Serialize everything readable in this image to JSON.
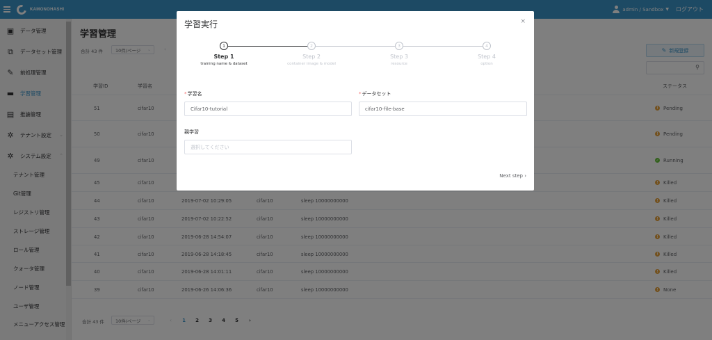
{
  "header": {
    "logo_text": "KAMONOHASHI",
    "user": "admin / Sandbox",
    "caret": "▼",
    "logout": "ログアウト"
  },
  "sidebar": {
    "items": [
      {
        "label": "データ管理",
        "icon": "data-icon",
        "glyph": "▣"
      },
      {
        "label": "データセット管理",
        "icon": "dataset-icon",
        "glyph": "⧉"
      },
      {
        "label": "前処理管理",
        "icon": "edit-icon",
        "glyph": "✎"
      },
      {
        "label": "学習管理",
        "icon": "training-icon",
        "glyph": "▬"
      },
      {
        "label": "推論管理",
        "icon": "inference-icon",
        "glyph": "▤"
      },
      {
        "label": "テナント設定",
        "icon": "gear-icon",
        "glyph": "✲",
        "chevron": "⌄"
      },
      {
        "label": "システム設定",
        "icon": "gears-icon",
        "glyph": "✲",
        "chevron": "⌃"
      }
    ],
    "sub_items": [
      "テナント管理",
      "Git管理",
      "レジストリ管理",
      "ストレージ管理",
      "ロール管理",
      "クォータ管理",
      "ノード管理",
      "ユーザ管理",
      "メニューアクセス管理"
    ]
  },
  "main": {
    "title": "学習管理",
    "total": "合計 43 件",
    "per_page": "10件/ページ",
    "new_button": "新規登録",
    "columns": [
      "学習ID",
      "学習名",
      "ステータス"
    ],
    "rows": [
      {
        "id": "51",
        "name": "cifar10",
        "date": "",
        "dataset": "",
        "command": "",
        "status": "Pending",
        "color": "#e6a23c",
        "sym": "!"
      },
      {
        "id": "50",
        "name": "cifar10",
        "date": "",
        "dataset": "",
        "command": "",
        "status": "Pending",
        "color": "#e6a23c",
        "sym": "!"
      },
      {
        "id": "49",
        "name": "cifar10",
        "date": "",
        "dataset": "",
        "command": "",
        "status": "Running",
        "color": "#67c23a",
        "sym": "✓"
      },
      {
        "id": "45",
        "name": "cifar10",
        "date": "",
        "dataset": "",
        "command": "",
        "status": "Killed",
        "color": "#e6a23c",
        "sym": "!"
      },
      {
        "id": "44",
        "name": "cifar10",
        "date": "2019-07-02 10:29:05",
        "dataset": "cifar10",
        "command": "sleep 10000000000",
        "status": "Killed",
        "color": "#e6a23c",
        "sym": "!"
      },
      {
        "id": "43",
        "name": "cifar10",
        "date": "2019-07-02 10:22:52",
        "dataset": "cifar10",
        "command": "sleep 10000000000",
        "status": "Killed",
        "color": "#e6a23c",
        "sym": "!"
      },
      {
        "id": "42",
        "name": "cifar10",
        "date": "2019-06-28 14:54:07",
        "dataset": "cifar10",
        "command": "sleep 10000000000",
        "status": "Killed",
        "color": "#e6a23c",
        "sym": "!"
      },
      {
        "id": "41",
        "name": "cifar10",
        "date": "2019-06-28 14:18:45",
        "dataset": "cifar10",
        "command": "sleep 10000000000",
        "status": "Killed",
        "color": "#e6a23c",
        "sym": "!"
      },
      {
        "id": "40",
        "name": "cifar10",
        "date": "2019-06-28 14:01:11",
        "dataset": "cifar10",
        "command": "sleep 10000000000",
        "status": "Killed",
        "color": "#e6a23c",
        "sym": "!"
      },
      {
        "id": "39",
        "name": "cifar10",
        "date": "2019-06-26 14:06:36",
        "dataset": "cifar10",
        "command": "sleep 10000000000",
        "status": "None",
        "color": "#e6a23c",
        "sym": "!"
      }
    ],
    "pager": {
      "prev": "‹",
      "pages": [
        "1",
        "2",
        "3",
        "4",
        "5"
      ],
      "next": "›",
      "current": "1"
    }
  },
  "modal": {
    "title": "学習実行",
    "close": "×",
    "steps": [
      {
        "num": "1",
        "name": "Step 1",
        "desc": "training name & dataset"
      },
      {
        "num": "2",
        "name": "Step 2",
        "desc": "container image & model"
      },
      {
        "num": "3",
        "name": "Step 3",
        "desc": "resource"
      },
      {
        "num": "4",
        "name": "Step 4",
        "desc": "option"
      }
    ],
    "name_label": "学習名",
    "name_value": "Cifar10-tutorial",
    "dataset_label": "データセット",
    "dataset_value": "cifar10-file-base",
    "parent_label": "親学習",
    "parent_placeholder": "選択してください",
    "required_mark": "*",
    "next": "Next step ›"
  }
}
